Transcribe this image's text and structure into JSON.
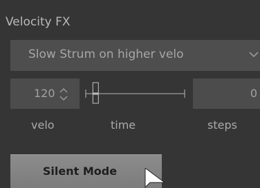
{
  "panel": {
    "title": "Velocity FX"
  },
  "preset_dropdown": {
    "selected": "Slow Strum on higher velo",
    "icon": "chevron-down-icon"
  },
  "velo": {
    "value": "120",
    "icon": "up-down-arrows-icon",
    "caption": "velo"
  },
  "time": {
    "caption": "time",
    "slider_level": 0.1
  },
  "steps": {
    "value": "0",
    "caption": "steps"
  },
  "silent_mode": {
    "label": "Silent Mode"
  },
  "colors": {
    "panel_bg": "#353535",
    "control_bg": "#4c4c4c",
    "text": "#aaaaaa",
    "button": "#868686"
  }
}
